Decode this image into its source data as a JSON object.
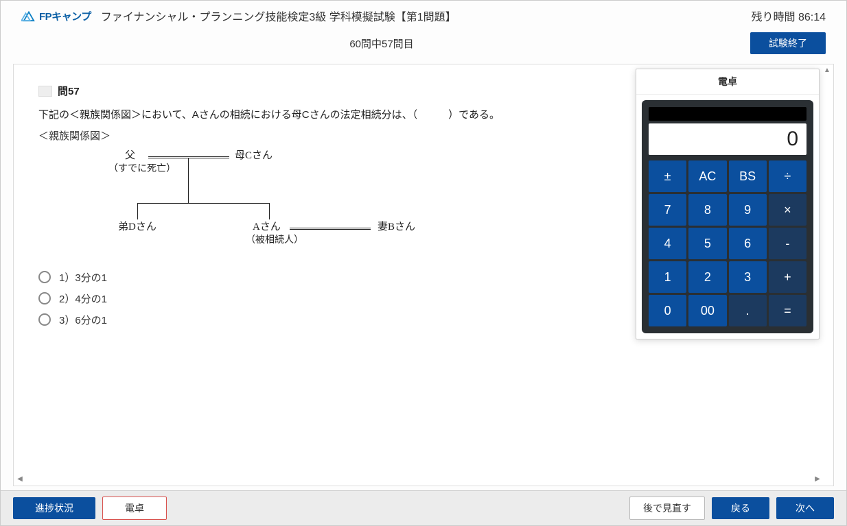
{
  "header": {
    "logo_text": "FPキャンプ",
    "exam_title": "ファイナンシャル・プランニング技能検定3級 学科模擬試験【第1問題】",
    "timer_label": "残り時間",
    "timer_value": "86:14"
  },
  "subheader": {
    "progress": "60問中57問目",
    "end_exam": "試験終了"
  },
  "question": {
    "number_label": "問57",
    "text": "下記の＜親族関係図＞において、Aさんの相続における母Cさんの法定相続分は、（　　　）である。",
    "diagram_title": "＜親族関係図＞"
  },
  "diagram": {
    "father": "父",
    "father_sub": "（すでに死亡）",
    "mother": "母Cさん",
    "brother": "弟Dさん",
    "a": "Aさん",
    "a_sub": "（被相続人）",
    "wife": "妻Bさん"
  },
  "options": [
    {
      "label": "1）3分の1"
    },
    {
      "label": "2）4分の1"
    },
    {
      "label": "3）6分の1"
    }
  ],
  "calculator": {
    "title": "電卓",
    "display": "0",
    "buttons": [
      "±",
      "AC",
      "BS",
      "÷",
      "7",
      "8",
      "9",
      "×",
      "4",
      "5",
      "6",
      "-",
      "1",
      "2",
      "3",
      "+",
      "0",
      "00",
      ".",
      "="
    ]
  },
  "footer": {
    "progress_btn": "進捗状況",
    "calc_btn": "電卓",
    "review_btn": "後で見直す",
    "back_btn": "戻る",
    "next_btn": "次へ"
  }
}
